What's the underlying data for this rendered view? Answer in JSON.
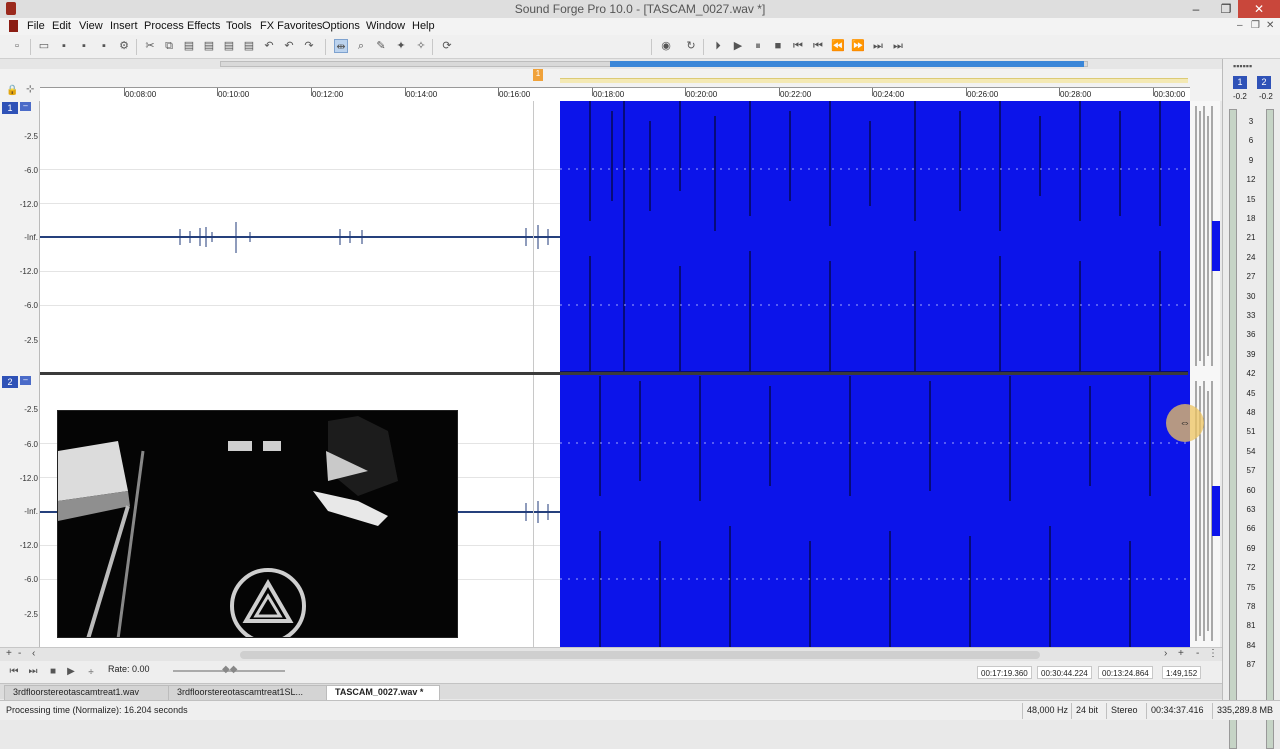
{
  "window": {
    "title": "Sound Forge Pro 10.0 - [TASCAM_0027.wav *]"
  },
  "menu": [
    "File",
    "Edit",
    "View",
    "Insert",
    "Process",
    "Effects",
    "Tools",
    "FX Favorites",
    "Options",
    "Window",
    "Help"
  ],
  "ruler": {
    "marker_label": "1",
    "ticks": [
      "00:08:00",
      "00:10:00",
      "00:12:00",
      "00:14:00",
      "00:16:00",
      "00:18:00",
      "00:20:00",
      "00:22:00",
      "00:24:00",
      "00:26:00",
      "00:28:00",
      "00:30:00"
    ]
  },
  "channels": [
    {
      "number": "1",
      "db_labels": [
        "-2.5",
        "-6.0",
        "-12.0",
        "-Inf.",
        "-12.0",
        "-6.0",
        "-2.5"
      ]
    },
    {
      "number": "2",
      "db_labels": [
        "-2.5",
        "-6.0",
        "-12.0",
        "-Inf.",
        "-12.0",
        "-6.0",
        "-2.5"
      ]
    }
  ],
  "meters": {
    "channels": [
      "1",
      "2"
    ],
    "peaks": [
      "-0.2",
      "-0.2"
    ],
    "scale": [
      "3",
      "6",
      "9",
      "12",
      "15",
      "18",
      "21",
      "24",
      "27",
      "30",
      "33",
      "36",
      "39",
      "42",
      "45",
      "48",
      "51",
      "54",
      "57",
      "60",
      "63",
      "66",
      "69",
      "72",
      "75",
      "78",
      "81",
      "84",
      "87"
    ]
  },
  "transport": {
    "rate_label": "Rate: 0.00",
    "selection_start": "00:17:19.360",
    "selection_end": "00:30:44.224",
    "selection_length": "00:13:24.864",
    "zoom_ratio": "1:49,152"
  },
  "tabs": [
    "3rdfloorstereotascamtreat1.wav",
    "3rdfloorstereotascamtreat1SL...",
    "TASCAM_0027.wav *"
  ],
  "status": {
    "message": "Processing time (Normalize): 16.204 seconds",
    "sample_rate": "48,000 Hz",
    "bit_depth": "24 bit",
    "channels": "Stereo",
    "length": "00:34:37.416",
    "free_space": "335,289.8 MB"
  },
  "colors": {
    "selection": "#0c14ea",
    "channel_badge": "#2f52b7",
    "marker": "#f0a23a",
    "scroll_view": "#3a86d8"
  },
  "icons": [
    "new-file-icon",
    "open-icon",
    "save-icon",
    "cut-icon",
    "copy-icon",
    "paste-icon",
    "undo-icon",
    "redo-icon",
    "edit-tool-icon",
    "magnify-icon",
    "pencil-icon",
    "record-icon",
    "loop-icon",
    "play-icon",
    "stop-icon"
  ]
}
